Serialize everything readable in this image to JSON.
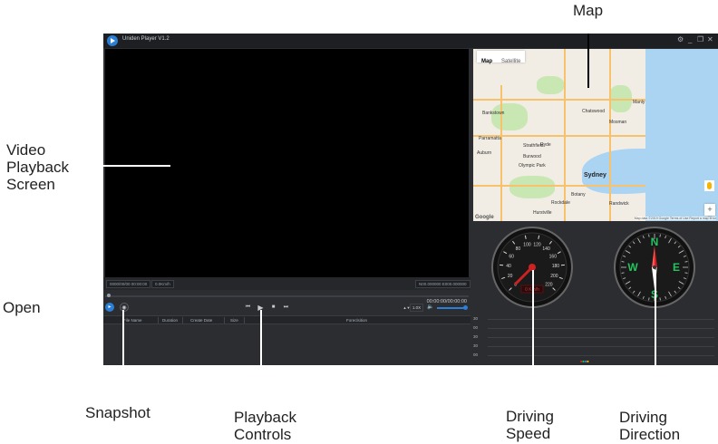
{
  "callouts": {
    "map": "Map",
    "video_line1": "Video",
    "video_line2": "Playback",
    "video_line3": "Screen",
    "open": "Open",
    "snapshot": "Snapshot",
    "playback_line1": "Playback",
    "playback_line2": "Controls",
    "speed_line1": "Driving",
    "speed_line2": "Speed",
    "direction_line1": "Driving",
    "direction_line2": "Direction"
  },
  "app": {
    "title": "Uniden Player V1.2",
    "window_controls": {
      "settings_icon": "gear-icon",
      "minimize": "_",
      "restore": "❐",
      "close": "✕"
    }
  },
  "info_bar": {
    "datetime": "0000/00/00 00:00:00",
    "speed": "0.0Km/h",
    "coords": "N00.000000 E000.000000"
  },
  "controls": {
    "timecode": "00:00:00/00:00:00",
    "speed": "1.0X",
    "prev_icon": "skip-back-icon",
    "play_icon": "play-icon",
    "stop_icon": "stop-icon",
    "next_icon": "skip-forward-icon",
    "volume_level": 1.0
  },
  "file_table": {
    "columns": [
      "File Name",
      "Duration",
      "Create Date",
      "Size",
      "Foreclsition"
    ]
  },
  "map": {
    "tabs": [
      "Map",
      "Satellite"
    ],
    "active_tab": "Map",
    "city": "Sydney",
    "suburbs": [
      "Bankstown",
      "Parramatta",
      "Burwood",
      "Olympic Park",
      "Strathfield",
      "Auburn",
      "Ryde",
      "Chatswood",
      "Mosman",
      "Manly",
      "Randwick",
      "Hurstville",
      "Rockdale",
      "Botany"
    ],
    "zoom_in": "+",
    "zoom_out": "−",
    "logo": "Google",
    "attribution": "Map data ©2019 Google  Terms of Use  Report a map error"
  },
  "speedometer": {
    "ticks": [
      "0",
      "20",
      "40",
      "60",
      "80",
      "100",
      "120",
      "140",
      "160",
      "180",
      "200",
      "220"
    ],
    "value": 0,
    "unit_display": "0 Km/h"
  },
  "compass": {
    "cardinals": [
      "N",
      "E",
      "S",
      "W"
    ],
    "heading": "NW"
  },
  "graph": {
    "labels": [
      "30",
      "00",
      "30",
      "30",
      "00"
    ]
  },
  "colors": {
    "accent": "#2b7fd6",
    "app_bg": "#2b2d31",
    "needle": "#cc2222",
    "compass_green": "#22c55e"
  }
}
